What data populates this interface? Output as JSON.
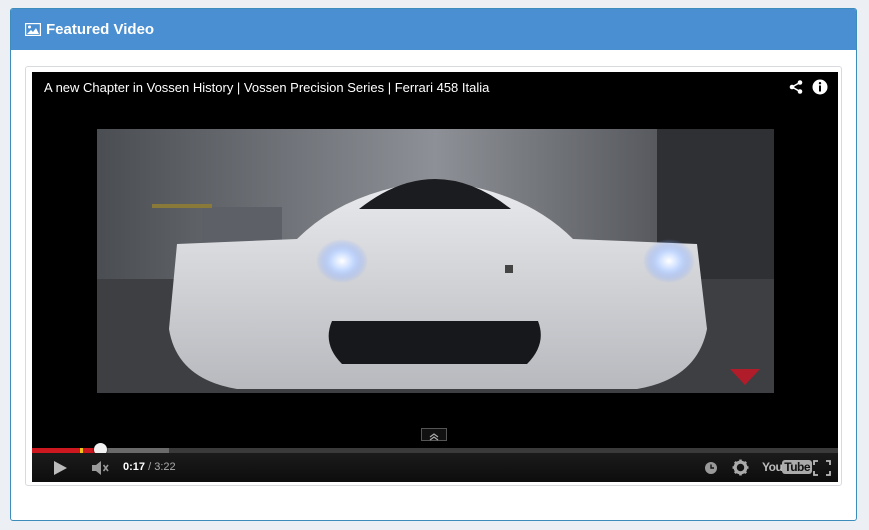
{
  "panel": {
    "title": "Featured Video",
    "title_icon": "image-icon"
  },
  "video": {
    "title": "A new Chapter in Vossen History | Vossen Precision Series | Ferrari 458 Italia",
    "current_time": "0:17",
    "separator": " / ",
    "duration": "3:22",
    "played_fraction": 0.084,
    "buffered_fraction": 0.17
  },
  "controls": {
    "play_icon": "play-icon",
    "volume_icon": "volume-icon",
    "watch_later_icon": "clock-icon",
    "settings_icon": "gear-icon",
    "youtube_logo_you": "You",
    "youtube_logo_tube": "Tube",
    "fullscreen_icon": "fullscreen-icon",
    "share_icon": "share-icon",
    "info_icon": "info-icon",
    "expand_icon": "chevron-up-double-icon"
  },
  "colors": {
    "header": "#4a8fd1",
    "progress_played": "#cc181e",
    "ad_marker": "#f0c419"
  }
}
